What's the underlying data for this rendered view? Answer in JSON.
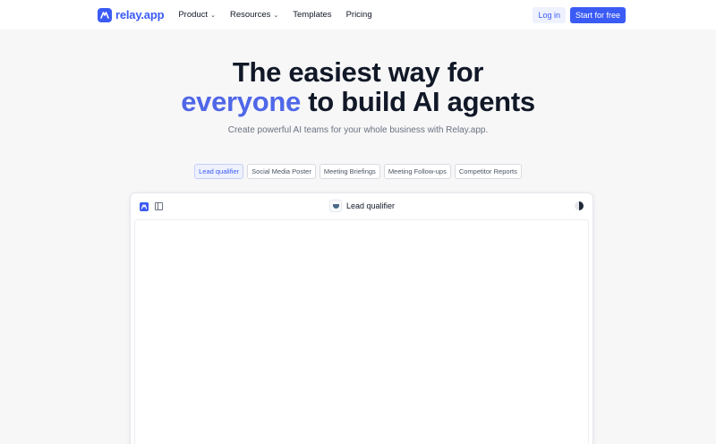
{
  "header": {
    "logo_text": "relay.app",
    "nav": [
      {
        "label": "Product",
        "has_dropdown": true
      },
      {
        "label": "Resources",
        "has_dropdown": true
      },
      {
        "label": "Templates",
        "has_dropdown": false
      },
      {
        "label": "Pricing",
        "has_dropdown": false
      }
    ],
    "login_label": "Log in",
    "start_label": "Start for free"
  },
  "hero": {
    "title_line1": "The easiest way for",
    "title_accent": "everyone",
    "title_line2_rest": " to build AI agents",
    "subtitle": "Create powerful AI teams for your whole business with Relay.app."
  },
  "tabs": [
    {
      "label": "Lead qualifier",
      "active": true
    },
    {
      "label": "Social Media Poster",
      "active": false
    },
    {
      "label": "Meeting Briefings",
      "active": false
    },
    {
      "label": "Meeting Follow-ups",
      "active": false
    },
    {
      "label": "Competitor Reports",
      "active": false
    }
  ],
  "preview": {
    "title": "Lead qualifier"
  },
  "colors": {
    "brand": "#3b5bf5",
    "accent_text": "#4f67e8",
    "background": "#f7f7f8"
  },
  "icons": [
    "relay-logo-icon",
    "chevron-down-icon",
    "sidebar-panel-icon",
    "agent-avatar-icon",
    "user-avatar-icon"
  ]
}
